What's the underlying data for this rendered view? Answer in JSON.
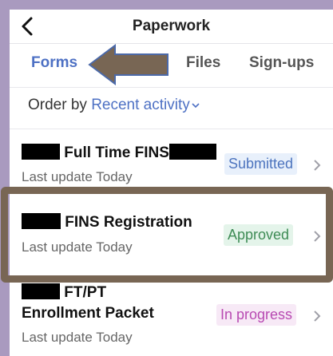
{
  "header": {
    "title": "Paperwork",
    "back_icon": "chevron-left-icon"
  },
  "tabs": [
    {
      "label": "Forms",
      "active": true
    },
    {
      "label": "Files",
      "active": false
    },
    {
      "label": "Sign-ups",
      "active": false
    }
  ],
  "order": {
    "label": "Order by",
    "value": "Recent activity"
  },
  "forms": [
    {
      "title": "Full Time FINS",
      "subtitle": "Last update Today",
      "status": "Submitted"
    },
    {
      "title": "FINS Registration",
      "subtitle": "Last update Today",
      "status": "Approved"
    },
    {
      "title_line1": "FT/PT",
      "title_line2": "Enrollment Packet",
      "subtitle": "Last update Today",
      "status": "In progress"
    }
  ],
  "colors": {
    "accent": "#4e71c4",
    "submitted": "#4d74be",
    "approved": "#3f8c56",
    "in_progress": "#b84ab2",
    "annotation": "#786654"
  }
}
